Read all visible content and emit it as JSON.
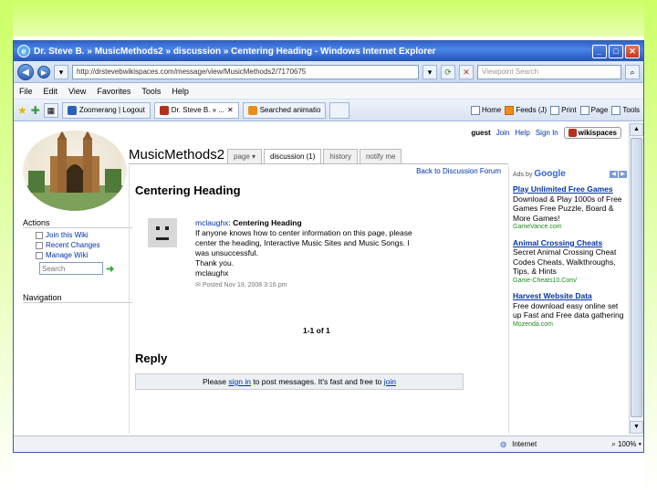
{
  "window": {
    "title": "Dr. Steve B. » MusicMethods2 » discussion » Centering Heading - Windows Internet Explorer",
    "address": "http://drstevebwikispaces.com/message/view/MusicMethods2/7170675",
    "search_placeholder": "Viewpoint Search"
  },
  "menu": [
    "File",
    "Edit",
    "View",
    "Favorites",
    "Tools",
    "Help"
  ],
  "tabs": [
    {
      "label": "Zoomerang | Logout"
    },
    {
      "label": "Dr. Steve B. » ..."
    },
    {
      "label": "Searched animatio"
    }
  ],
  "toolbar": {
    "home": "Home",
    "feeds": "Feeds (J)",
    "print": "Print",
    "page": "Page",
    "tools": "Tools"
  },
  "status": {
    "text": "Internet",
    "zoom": "100%"
  },
  "wiki": {
    "userbar": {
      "guest": "guest",
      "join": "Join",
      "help": "Help",
      "sign_in": "Sign In",
      "badge": "wikispaces"
    },
    "title": "MusicMethods2",
    "tabs": [
      "page",
      "discussion (1)",
      "history",
      "notify me"
    ],
    "sidebar": {
      "actions_heading": "Actions",
      "items": [
        "Join this Wiki",
        "Recent Changes",
        "Manage Wiki"
      ],
      "search_placeholder": "Search",
      "navigation_heading": "Navigation"
    },
    "back_link": "Back to Discussion Forum",
    "page_heading": "Centering Heading",
    "post": {
      "author": "mclaughx",
      "subject": "Centering Heading",
      "body_lines": [
        "If anyone knows how to center information on this page, please",
        "center the heading, Interactive Music Sites and Music Songs. I",
        "was unsuccessful.",
        "Thank you.",
        "mclaughx"
      ],
      "meta": "Posted Nov 19, 2008 3:16 pm"
    },
    "pager": "1-1 of 1",
    "reply_heading": "Reply",
    "reply_box": {
      "prefix": "Please",
      "sign_in": "sign in",
      "middle": "to post messages. It's fast and free to",
      "join": "join"
    },
    "ads": {
      "ads_by": "Ads by",
      "google": "Google",
      "items": [
        {
          "title": "Play Unlimited Free Games",
          "text": "Download & Play 1000s of Free Games Free Puzzle, Board & More Games!",
          "url": "GameVance.com"
        },
        {
          "title": "Animal Crossing Cheats",
          "text": "Secret Animal Crossing Cheat Codes Cheats, Walkthroughs, Tips, & Hints",
          "url": "Game-Cheats10.Com/"
        },
        {
          "title": "Harvest Website Data",
          "text": "Free download easy online set up Fast and Free data gathering",
          "url": "Mozenda.com"
        }
      ]
    }
  }
}
